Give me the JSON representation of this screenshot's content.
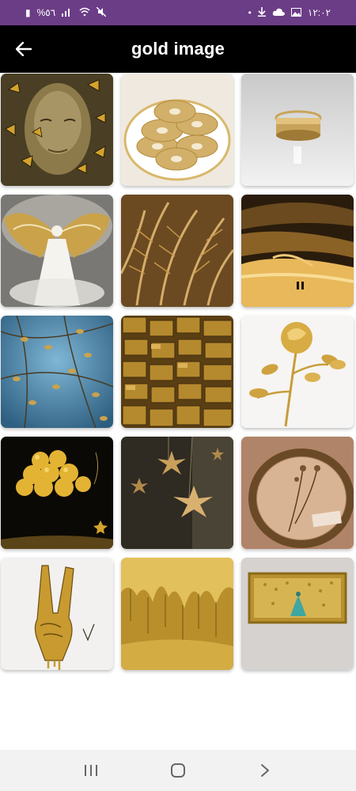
{
  "status_bar": {
    "time": "١٢:٠٢",
    "battery": "%٥٦",
    "background": "#6b3d86"
  },
  "app_bar": {
    "title": "gold image",
    "back_icon": "arrow-left-icon"
  },
  "gallery": {
    "items": [
      {
        "name": "gold-face-butterflies"
      },
      {
        "name": "gold-glitter-donuts"
      },
      {
        "name": "gold-rings"
      },
      {
        "name": "gold-angel-wings"
      },
      {
        "name": "gold-feathers"
      },
      {
        "name": "gold-sunset-beach"
      },
      {
        "name": "gold-leaves-blue"
      },
      {
        "name": "gold-tiles"
      },
      {
        "name": "gold-rose"
      },
      {
        "name": "gold-balloons"
      },
      {
        "name": "gold-stars"
      },
      {
        "name": "gold-frame-flowers"
      },
      {
        "name": "gold-peace-hand"
      },
      {
        "name": "gold-drip-texture"
      },
      {
        "name": "gold-peacock-frame"
      }
    ]
  },
  "nav_bar": {
    "recents_icon": "recents-icon",
    "home_icon": "home-icon",
    "back_icon": "chevron-right-icon"
  }
}
